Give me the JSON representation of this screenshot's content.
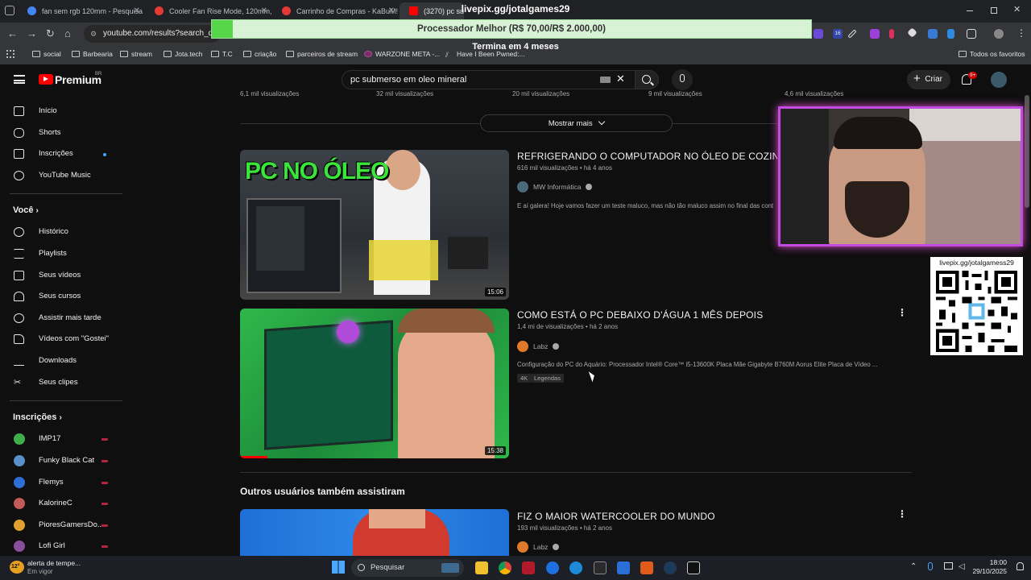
{
  "browser": {
    "tabs": [
      {
        "title": "fan sem rgb 120mm - Pesquisa",
        "color": "#4285f4"
      },
      {
        "title": "Cooler Fan Rise Mode, 120mm,",
        "color": "#e53935"
      },
      {
        "title": "Carrinho de Compras - KaBuM!",
        "color": "#e53935"
      },
      {
        "title": "(3270) pc sub",
        "color": "#ff0000"
      }
    ],
    "url": "youtube.com/results?search_que",
    "bookmarks": [
      "social",
      "Barbearia",
      "stream",
      "Jota.tech",
      "T.C",
      "criação",
      "parceiros de stream",
      "WARZONE META -...",
      "Have I Been Pwned:..."
    ],
    "all_bookmarks": "Todos os favoritos",
    "ext_badge": "16"
  },
  "overlay": {
    "title": "livepix.gg/jotalgames29",
    "goal_text": "Processador Melhor (R$ 70,00/R$ 2.000,00)",
    "goal_fraction": 0.035,
    "goal_sub": "Termina em 4 meses",
    "qr_label": "livepix.gg/jotalgamess29"
  },
  "youtube": {
    "logo": "Premium",
    "region": "BR",
    "search_query": "pc submerso em oleo mineral",
    "create_label": "Criar",
    "notif_count": "9+",
    "sidebar": {
      "main": [
        "Início",
        "Shorts",
        "Inscrições",
        "YouTube Music"
      ],
      "voce_header": "Você",
      "voce": [
        "Histórico",
        "Playlists",
        "Seus vídeos",
        "Seus cursos",
        "Assistir mais tarde",
        "Vídeos com \"Gostei\"",
        "Downloads",
        "Seus clipes"
      ],
      "subs_header": "Inscrições",
      "subs": [
        {
          "name": "IMP17",
          "color": "#3fae4b"
        },
        {
          "name": "Funky Black Cat",
          "color": "#5a8fc8"
        },
        {
          "name": "Flemys",
          "color": "#2d6fd6"
        },
        {
          "name": "KalorineC",
          "color": "#c25a5a"
        },
        {
          "name": "PioresGamersDo...",
          "color": "#e0a030"
        },
        {
          "name": "Lofi Girl",
          "color": "#8a4f9c"
        }
      ]
    },
    "top_views": [
      "6,1 mil visualizações",
      "32 mil visualizações",
      "20 mil visualizações",
      "9 mil visualizações",
      "4,6 mil visualizações"
    ],
    "show_more": "Mostrar mais",
    "videos": [
      {
        "title": "REFRIGERANDO O COMPUTADOR NO ÓLEO DE COZINHA, SE",
        "meta": "616 mil visualizações  •  há 4 anos",
        "channel": "MW Informática",
        "desc": "E aí galera! Hoje vamos fazer um teste maluco, mas não tão maluco assim no final das cont",
        "duration": "15:06",
        "thumb_text": "PC NO ÓLEO"
      },
      {
        "title": "COMO ESTÁ O PC DEBAIXO D'ÁGUA 1 MÊS DEPOIS",
        "meta": "1,4 mi de visualizações  •  há 2 anos",
        "channel": "Labz",
        "desc": "Configuração do PC do Aquário: Processador Intel® Core™ i5-13600K Placa Mãe Gigabyte B760M Aorus Elite Placa de Vídeo ...",
        "badges": [
          "4K",
          "Legendas"
        ],
        "duration": "15:38"
      },
      {
        "title": "FIZ O MAIOR WATERCOOLER DO MUNDO",
        "meta": "193 mil visualizações  •  há 2 anos",
        "channel": "Labz"
      }
    ],
    "section_title": "Outros usuários também assistiram"
  },
  "taskbar": {
    "weather_line1": "alerta de tempe...",
    "weather_line2": "Em vigor",
    "weather_temp": "12°",
    "search_label": "Pesquisar",
    "time": "18:00",
    "date": "29/10/2025"
  }
}
